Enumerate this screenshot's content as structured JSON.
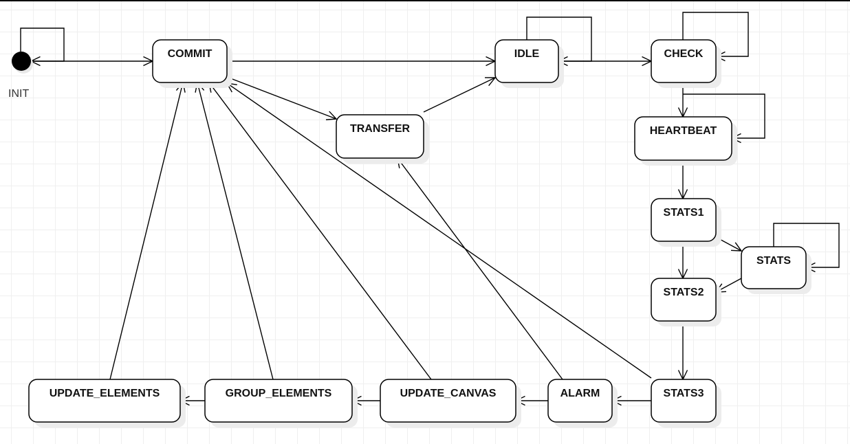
{
  "diagram": {
    "initial": {
      "id": "INIT",
      "label": "INIT"
    },
    "states": [
      {
        "id": "COMMIT",
        "label": "COMMIT"
      },
      {
        "id": "IDLE",
        "label": "IDLE"
      },
      {
        "id": "CHECK",
        "label": "CHECK"
      },
      {
        "id": "TRANSFER",
        "label": "TRANSFER"
      },
      {
        "id": "HEARTBEAT",
        "label": "HEARTBEAT"
      },
      {
        "id": "STATS1",
        "label": "STATS1"
      },
      {
        "id": "STATS",
        "label": "STATS"
      },
      {
        "id": "STATS2",
        "label": "STATS2"
      },
      {
        "id": "STATS3",
        "label": "STATS3"
      },
      {
        "id": "ALARM",
        "label": "ALARM"
      },
      {
        "id": "UPDATE_CANVAS",
        "label": "UPDATE_CANVAS"
      },
      {
        "id": "GROUP_ELEMENTS",
        "label": "GROUP_ELEMENTS"
      },
      {
        "id": "UPDATE_ELEMENTS",
        "label": "UPDATE_ELEMENTS"
      }
    ],
    "transitions": [
      {
        "from": "INIT",
        "to": "INIT"
      },
      {
        "from": "INIT",
        "to": "COMMIT"
      },
      {
        "from": "COMMIT",
        "to": "IDLE"
      },
      {
        "from": "COMMIT",
        "to": "TRANSFER"
      },
      {
        "from": "TRANSFER",
        "to": "IDLE"
      },
      {
        "from": "IDLE",
        "to": "IDLE"
      },
      {
        "from": "IDLE",
        "to": "CHECK"
      },
      {
        "from": "CHECK",
        "to": "CHECK"
      },
      {
        "from": "CHECK",
        "to": "HEARTBEAT"
      },
      {
        "from": "HEARTBEAT",
        "to": "HEARTBEAT"
      },
      {
        "from": "HEARTBEAT",
        "to": "STATS1"
      },
      {
        "from": "STATS1",
        "to": "STATS"
      },
      {
        "from": "STATS",
        "to": "STATS"
      },
      {
        "from": "STATS",
        "to": "STATS2"
      },
      {
        "from": "STATS1",
        "to": "STATS2"
      },
      {
        "from": "STATS2",
        "to": "STATS3"
      },
      {
        "from": "STATS3",
        "to": "ALARM"
      },
      {
        "from": "ALARM",
        "to": "UPDATE_CANVAS"
      },
      {
        "from": "UPDATE_CANVAS",
        "to": "GROUP_ELEMENTS"
      },
      {
        "from": "GROUP_ELEMENTS",
        "to": "UPDATE_ELEMENTS"
      },
      {
        "from": "UPDATE_ELEMENTS",
        "to": "COMMIT"
      },
      {
        "from": "GROUP_ELEMENTS",
        "to": "COMMIT"
      },
      {
        "from": "UPDATE_CANVAS",
        "to": "COMMIT"
      },
      {
        "from": "STATS3",
        "to": "COMMIT"
      },
      {
        "from": "ALARM",
        "to": "TRANSFER"
      }
    ]
  }
}
